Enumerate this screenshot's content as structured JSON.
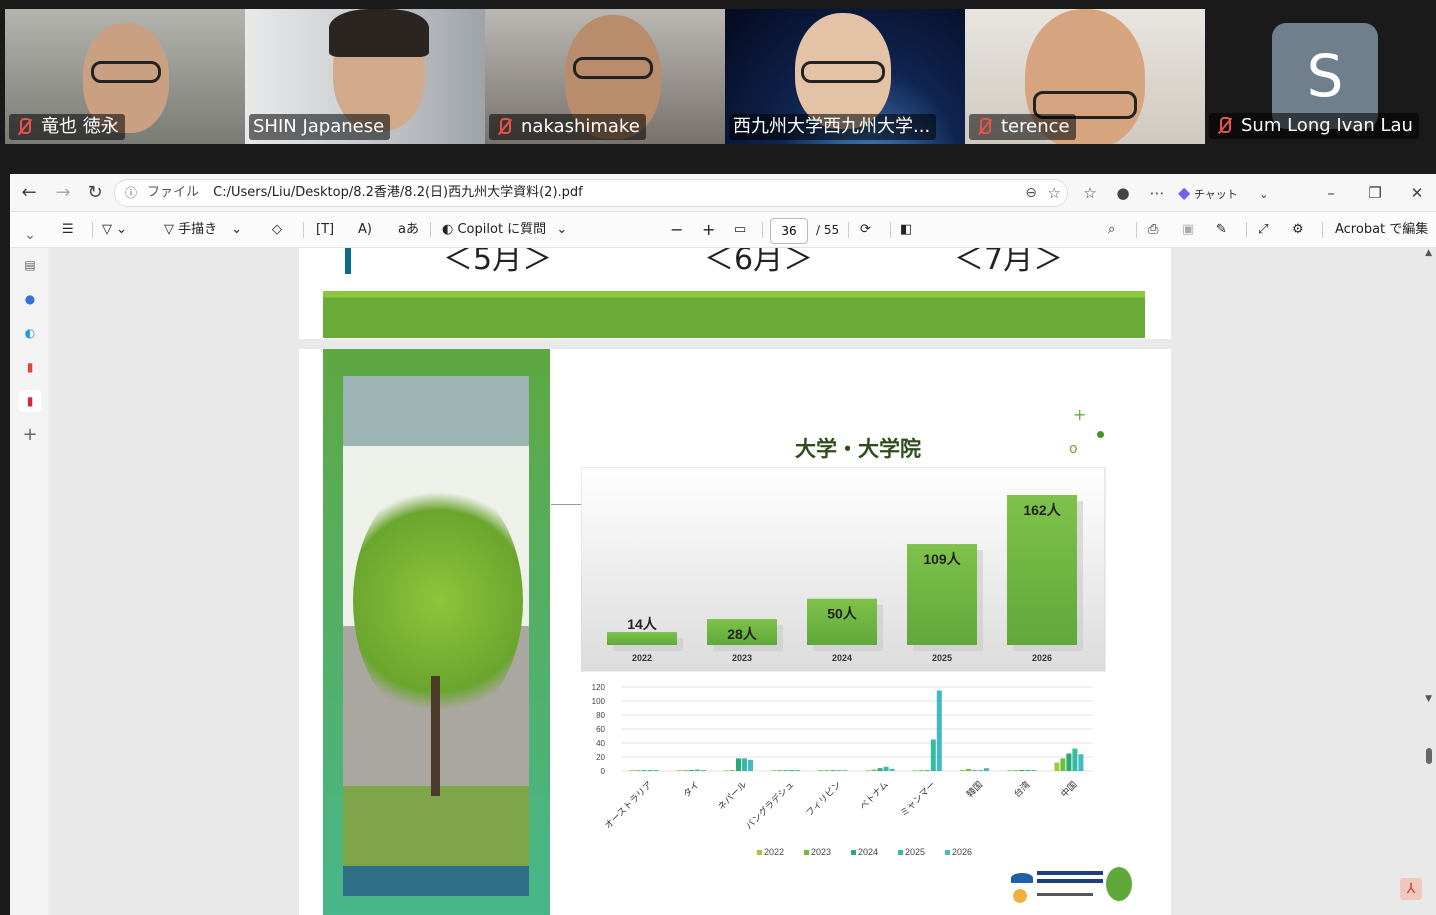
{
  "participants": [
    {
      "name": "竜也 徳永",
      "muted": true
    },
    {
      "name": "SHIN Japanese",
      "muted": false
    },
    {
      "name": "nakashimake",
      "muted": true
    },
    {
      "name": "西九州大学西九州大学...",
      "muted": false,
      "active": true
    },
    {
      "name": "terence",
      "muted": true
    },
    {
      "name": "Sum Long Ivan Lau",
      "muted": true,
      "avatar": "S"
    }
  ],
  "browser": {
    "url_label": "ファイル",
    "url": "C:/Users/Liu/Desktop/8.2香港/8.2(日)西九州大学資料(2).pdf",
    "chat_label": "チャット"
  },
  "toolbar": {
    "draw_label": "手描き",
    "copilot_label": "Copilot に質問",
    "page_current": "36",
    "page_total": "/ 55",
    "acrobat_label": "Acrobat で編集"
  },
  "slide_top": {
    "months": [
      "＜5月＞",
      "＜6月＞",
      "＜7月＞"
    ]
  },
  "slide": {
    "title": "大学・大学院",
    "decor": [
      "+",
      "o"
    ]
  },
  "chart_data": [
    {
      "type": "bar",
      "categories": [
        "2022",
        "2023",
        "2024",
        "2025",
        "2026"
      ],
      "values": [
        14,
        28,
        50,
        109,
        162
      ],
      "data_labels": [
        "14人",
        "28人",
        "50人",
        "109人",
        "162人"
      ],
      "title": ""
    },
    {
      "type": "bar",
      "categories": [
        "オーストラリア",
        "タイ",
        "ネパール",
        "バングラデシュ",
        "フィリピン",
        "ベトナム",
        "ミャンマー",
        "韓国",
        "台湾",
        "中国"
      ],
      "series": [
        {
          "name": "2022",
          "color": "#9ccc3c",
          "values": [
            0,
            0,
            0,
            0,
            1,
            0,
            0,
            1,
            0,
            12
          ]
        },
        {
          "name": "2023",
          "color": "#6bbf3a",
          "values": [
            0,
            0,
            0,
            0,
            0,
            2,
            0,
            3,
            0,
            18
          ]
        },
        {
          "name": "2024",
          "color": "#2aa87a",
          "values": [
            0,
            1,
            18,
            0,
            0,
            4,
            0,
            0,
            1,
            25
          ]
        },
        {
          "name": "2025",
          "color": "#35bba0",
          "values": [
            1,
            2,
            18,
            1,
            0,
            6,
            45,
            0,
            1,
            32
          ]
        },
        {
          "name": "2026",
          "color": "#45b8c8",
          "values": [
            1,
            1,
            16,
            1,
            0,
            3,
            115,
            4,
            1,
            24
          ]
        }
      ],
      "yticks": [
        "120",
        "100",
        "80",
        "60",
        "40",
        "20",
        "0"
      ],
      "ylim": [
        0,
        120
      ],
      "legend": "bottom"
    }
  ]
}
